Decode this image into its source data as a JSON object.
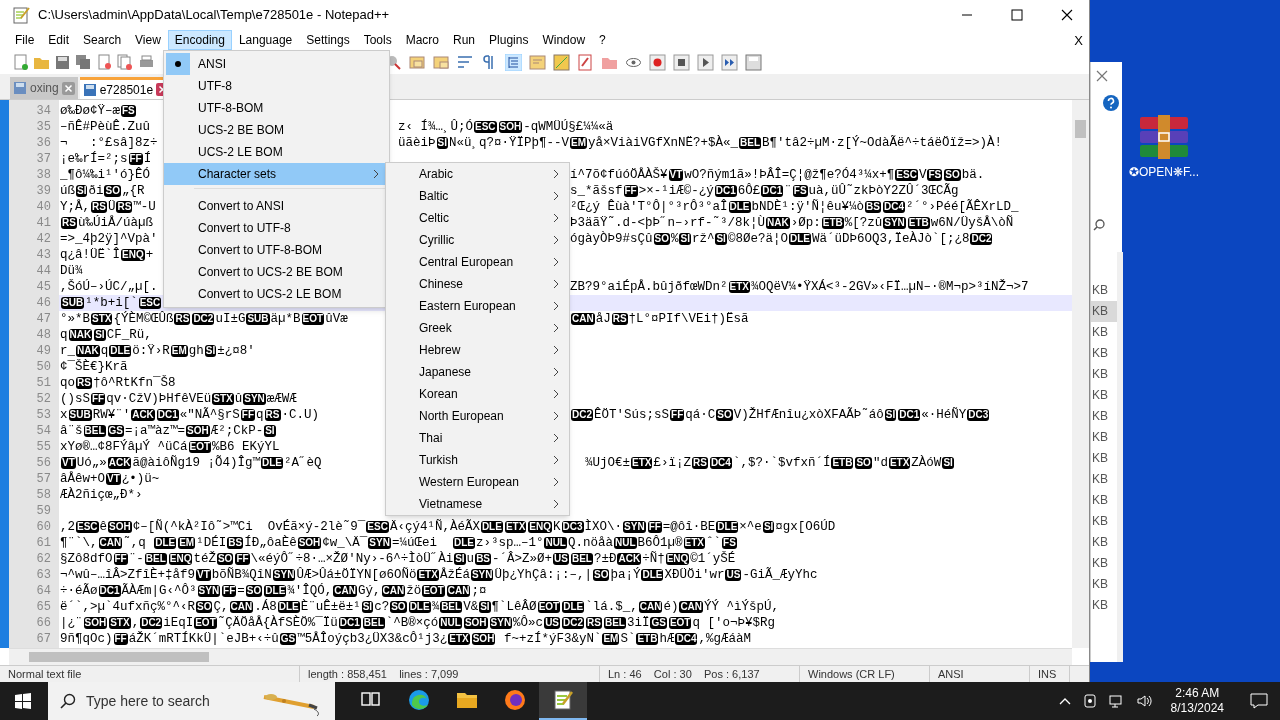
{
  "window": {
    "title": "C:\\Users\\admin\\AppData\\Local\\Temp\\e728501e - Notepad++"
  },
  "menu_bar": {
    "items": [
      {
        "label": "File",
        "selected": false
      },
      {
        "label": "Edit",
        "selected": false
      },
      {
        "label": "Search",
        "selected": false
      },
      {
        "label": "View",
        "selected": false
      },
      {
        "label": "Encoding",
        "selected": true
      },
      {
        "label": "Language",
        "selected": false
      },
      {
        "label": "Settings",
        "selected": false
      },
      {
        "label": "Tools",
        "selected": false
      },
      {
        "label": "Macro",
        "selected": false
      },
      {
        "label": "Run",
        "selected": false
      },
      {
        "label": "Plugins",
        "selected": false
      },
      {
        "label": "Window",
        "selected": false
      },
      {
        "label": "?",
        "selected": false
      }
    ],
    "close": "X"
  },
  "tabs": [
    {
      "label": "oxing",
      "selected": false
    },
    {
      "label": "e728501e",
      "selected": true
    }
  ],
  "editor": {
    "lines": [
      {
        "number": "34",
        "current": false,
        "left": [
          "ø‰Ðø¢Ÿ–æ",
          {
            "code": "FS"
          }
        ]
      },
      {
        "number": "35",
        "current": false,
        "left": [
          "–ñÊ#PèùÊ.Zuû"
        ],
        "right": [
          "z‹ Í¾…¸Û;Ó",
          {
            "code": "ESC"
          },
          {
            "code": "SOH"
          },
          "-qWMÜÚ§£¼¼«ä"
        ]
      },
      {
        "number": "36",
        "current": false,
        "left": [
          "¬   :°£sâ]8z÷"
        ],
        "right": [
          "üãèiÞ",
          {
            "code": "SI"
          },
          "N«ü¸q?¤·ŸÏPþ¶--V",
          {
            "code": "EM"
          },
          "yå×ViàiVGfXnNË?+$À«_",
          {
            "code": "BEL"
          },
          "B¶'tâ2÷µM·z[Ý~OdàÃë^÷táëÖïž=>)À!"
        ]
      },
      {
        "number": "37",
        "current": false,
        "left": [
          "¡e‰rÍ=²;s",
          {
            "code": "FF"
          },
          "Í"
        ]
      },
      {
        "number": "38",
        "current": false,
        "left": [
          "_¶ô¼‰i¹'ó}ÊÓ"
        ],
        "right": [
          "í^7õ¢fúóÖÅÀŠ¥",
          {
            "code": "VT"
          },
          "wO?ñým1ã»!ÞÂÎ=Ç¦@ž¶e?Ó4³¼x+¶",
          {
            "code": "ESC"
          },
          "V",
          {
            "code": "FS"
          },
          {
            "code": "SO"
          },
          "bä."
        ]
      },
      {
        "number": "39",
        "current": false,
        "left": [
          "úß",
          {
            "code": "SI"
          },
          "ði",
          {
            "code": "SO"
          },
          "„{R"
        ],
        "right": [
          "s_*ãšsf",
          {
            "code": "FF"
          },
          ">×-¹iÆ©-¿ý",
          {
            "code": "DC1"
          },
          "6Ô£",
          {
            "code": "DC1"
          },
          "¨",
          {
            "code": "FS"
          },
          "uà,üÛ˜zkÞòY2ZÛ´3ŒCÃg"
        ]
      },
      {
        "number": "40",
        "current": false,
        "left": [
          "Y;Å,",
          {
            "code": "RS"
          },
          "Ü",
          {
            "code": "RS"
          },
          "™-U"
        ],
        "right": [
          "²Œ¿ý Êùà'T°Ô|°³rÔ³°aÎ",
          {
            "code": "DLE"
          },
          "bNDÈ¹:ÿ'Ñ¦êu¥¼ò",
          {
            "code": "BS"
          },
          {
            "code": "DC4"
          },
          "²´°›Péé[ÃÊXrLD_"
        ]
      },
      {
        "number": "41",
        "current": false,
        "left": [
          {
            "code": "RS"
          },
          "ù‰ÚiÅ/úàµß"
        ],
        "right": [
          "Þ3äãŸ˜.d-<þÞ˝n–›rf-˜³/8k¦Ù",
          {
            "code": "NAK"
          },
          "›Øp:",
          {
            "code": "ETB"
          },
          "%[?zû",
          {
            "code": "SYN"
          },
          {
            "code": "ETB"
          },
          "w6N/ÜyšÅ\\òÑ"
        ]
      },
      {
        "number": "42",
        "current": false,
        "left": [
          "=>_4þ2ÿ]^Vpà'"
        ],
        "right": [
          "ógàyÒÞ9#sÇû",
          {
            "code": "SO"
          },
          "%",
          {
            "code": "SI"
          },
          "rž^",
          {
            "code": "SI"
          },
          "©8Øe?ä¦O",
          {
            "code": "DLE"
          },
          "Wä´üDÞ6OQ3,ÏeÀJò`[;¿8",
          {
            "code": "DC2"
          }
        ]
      },
      {
        "number": "43",
        "current": false,
        "left": [
          "q¿â!ÜË`Î",
          {
            "code": "ENQ"
          },
          "+"
        ]
      },
      {
        "number": "44",
        "current": false,
        "left": [
          "Dü¾"
        ]
      },
      {
        "number": "45",
        "current": false,
        "left": [
          ",ŠóÚ–›ÚC/„µ[."
        ],
        "right": [
          "ZB?9°aiÉpÅ.bûjðfœWDn²",
          {
            "code": "ETX"
          },
          "¾OQëV¼•ŸXÁ<³-2GV»‹FÏ…µN–·®M¬p>³íNŽ¬>7"
        ]
      },
      {
        "number": "46",
        "current": true,
        "left": [
          {
            "code": "SUB"
          },
          "¹*b+i[`",
          {
            "code": "ESC"
          }
        ]
      },
      {
        "number": "47",
        "current": false,
        "left": [
          "°»*B",
          {
            "code": "STX"
          },
          "{ÝÈM©ŒÛß",
          {
            "code": "RS"
          },
          {
            "code": "DC2"
          },
          "uI±G",
          {
            "code": "SUB"
          },
          "äµ*B",
          {
            "code": "EOT"
          },
          "ûVæ"
        ],
        "right": [
          {
            "code": "CAN"
          },
          "åJ",
          {
            "code": "RS"
          },
          "†L°¤PIf\\VEi†)Ësã"
        ]
      },
      {
        "number": "48",
        "current": false,
        "left": [
          "q",
          {
            "code": "NAK"
          },
          {
            "code": "SI"
          },
          "CF_Rü,"
        ]
      },
      {
        "number": "49",
        "current": false,
        "left": [
          "r_",
          {
            "code": "NAK"
          },
          "q",
          {
            "code": "DLE"
          },
          "ö:Ÿ›R",
          {
            "code": "EM"
          },
          "gh",
          {
            "code": "SI"
          },
          "±¿¤8'"
        ]
      },
      {
        "number": "50",
        "current": false,
        "left": [
          "¢¯ŠÈ€}Krã"
        ]
      },
      {
        "number": "51",
        "current": false,
        "left": [
          "qo",
          {
            "code": "RS"
          },
          "†ô^RtKfn¯Š8"
        ]
      },
      {
        "number": "52",
        "current": false,
        "left": [
          "()sS",
          {
            "code": "FF"
          },
          "qv·CžV)ÞHfêVEü",
          {
            "code": "STX"
          },
          "û",
          {
            "code": "SYN"
          },
          "æÆWÆ"
        ]
      },
      {
        "number": "53",
        "current": false,
        "left": [
          "x",
          {
            "code": "SUB"
          },
          "RW¥¨'",
          {
            "code": "ACK"
          },
          {
            "code": "DC1"
          },
          "«\"NÃ^§rS",
          {
            "code": "FF"
          },
          "q",
          {
            "code": "RS"
          },
          "·C.U)"
        ],
        "right": [
          {
            "code": "DC2"
          },
          "ÊÖT'Sús;sS",
          {
            "code": "FF"
          },
          "qá·C",
          {
            "code": "SO"
          },
          "V)ŽHfÆnîu¿xòXFAÃÞ˜áô",
          {
            "code": "SI"
          },
          {
            "code": "DC1"
          },
          "«·HéÑY",
          {
            "code": "DC3"
          }
        ]
      },
      {
        "number": "54",
        "current": false,
        "left": [
          "â¨š",
          {
            "code": "BEL"
          },
          {
            "code": "GS"
          },
          "=¡a™àz™=",
          {
            "code": "SOH"
          },
          "Æ²;CkP-",
          {
            "code": "SI"
          }
        ]
      },
      {
        "number": "55",
        "current": false,
        "left": [
          "xYø®…¢8FÝâµÝ ^üCá",
          {
            "code": "EOT"
          },
          "%B6 EKýYL"
        ]
      },
      {
        "number": "56",
        "current": false,
        "left": [
          {
            "code": "VT"
          },
          "Uó„»",
          {
            "code": "ACK"
          },
          "ã@àiôÑg19 ¡Õ4)Îg™",
          {
            "code": "DLE"
          },
          "²A˝èQ"
        ],
        "right": [
          "  ¾UjO€±",
          {
            "code": "ETX"
          },
          "£›ï¡Z",
          {
            "code": "RS"
          },
          {
            "code": "DC4"
          },
          "`,$?·`$vfxñ´Í",
          {
            "code": "ETB"
          },
          {
            "code": "SO"
          },
          "\"d",
          {
            "code": "ETX"
          },
          "ZÀóW",
          {
            "code": "SI"
          }
        ]
      },
      {
        "number": "57",
        "current": false,
        "left": [
          "âÅêw+O",
          {
            "code": "VT"
          },
          "¿•)ü~"
        ]
      },
      {
        "number": "58",
        "current": false,
        "left": [
          "ÆÀ2ñiçœ„Ð*›"
        ]
      },
      {
        "number": "59",
        "current": false
      },
      {
        "number": "60",
        "current": false,
        "left": [
          ",2",
          {
            "code": "ESC"
          },
          "ê",
          {
            "code": "SOH"
          },
          "¢–[Ñ(^kÀ²Iô˜>™Ci  OvÉã×ý-2lè˜9¯",
          {
            "code": "ESC"
          },
          "Ä‹çý4¹Ñ,ÀéÃX",
          {
            "code": "DLE"
          },
          {
            "code": "ETX"
          },
          {
            "code": "ENQ"
          },
          "K",
          {
            "code": "DC3"
          },
          "ÌXO\\·",
          {
            "code": "SYN"
          },
          {
            "code": "FF"
          },
          "=@ôî·BE",
          {
            "code": "DLE"
          },
          "×^e",
          {
            "code": "SI"
          },
          "¤gx[O6ÚD"
        ]
      },
      {
        "number": "61",
        "current": false,
        "left": [
          "¶¨`\\,",
          {
            "code": "CAN"
          },
          "˜,q ",
          {
            "code": "DLE"
          },
          {
            "code": "EM"
          },
          "¹DÉI",
          {
            "code": "BS"
          },
          "ÍÐ„ôaÈê",
          {
            "code": "SOH"
          },
          "¢w_\\Ä¯",
          {
            "code": "SYN"
          },
          "=¼úŒei  ",
          {
            "code": "DLE"
          },
          "z›³sp…–1°",
          {
            "code": "NUL"
          },
          "Q.nöåà",
          {
            "code": "NUL"
          },
          "B6Ô1µ®",
          {
            "code": "ETX"
          },
          "ˆ`",
          {
            "code": "FS"
          }
        ]
      },
      {
        "number": "62",
        "current": false,
        "left": [
          "§Zô8dfO",
          {
            "code": "FF"
          },
          "¨-",
          {
            "code": "BEL"
          },
          {
            "code": "ENQ"
          },
          "téŽ",
          {
            "code": "SO"
          },
          {
            "code": "FF"
          },
          "\\«éýÔ˝÷8·…×ŽØ'Ny›-6^÷ÌòÜ˝Ài",
          {
            "code": "SI"
          },
          "u",
          {
            "code": "BS"
          },
          "-´Â>Z»Ø+",
          {
            "code": "US"
          },
          {
            "code": "BEL"
          },
          "?±Ð",
          {
            "code": "ACK"
          },
          "÷Ñ†",
          {
            "code": "ENQ"
          },
          "©1´yŠÉ"
        ]
      },
      {
        "number": "63",
        "current": false,
        "left": [
          "¬^wû–…îÂ>ZfîÈ+‡åf9",
          {
            "code": "VT"
          },
          "bõÑB¾QîN",
          {
            "code": "SYN"
          },
          "ÛÆ>Ûá±ÖÏYN[ø6OÑö",
          {
            "code": "ETX"
          },
          "ÅžÉá",
          {
            "code": "SYN"
          },
          "Üþ¿YhÇâ:¡:–,|",
          {
            "code": "SO"
          },
          "þa¡Ý",
          {
            "code": "DLE"
          },
          "XÐÜÖi'wr",
          {
            "code": "US"
          },
          "-GiÃ_ÆyYhc"
        ]
      },
      {
        "number": "64",
        "current": false,
        "left": [
          "÷·éÃø",
          {
            "code": "DC1"
          },
          "ÃÀÆm|G‹^Ô³",
          {
            "code": "SYN"
          },
          {
            "code": "FF"
          },
          "=",
          {
            "code": "SO"
          },
          {
            "code": "DLE"
          },
          "¾'ÎQÓ,",
          {
            "code": "CAN"
          },
          "Gý,",
          {
            "code": "CAN"
          },
          "žö",
          {
            "code": "EOT"
          },
          {
            "code": "CAN"
          },
          ";¤"
        ]
      },
      {
        "number": "65",
        "current": false,
        "left": [
          "ë´`,>µ`4ufxñç%°^‹R",
          {
            "code": "SO"
          },
          "Ç,",
          {
            "code": "CAN"
          },
          ".Á8",
          {
            "code": "DLE"
          },
          "È¨uÊ±ë±¹",
          {
            "code": "SI"
          },
          "c?",
          {
            "code": "SO"
          },
          {
            "code": "DLE"
          },
          "¾",
          {
            "code": "BEL"
          },
          "V&",
          {
            "code": "SI"
          },
          "¶`LêÂØ",
          {
            "code": "EOT"
          },
          {
            "code": "DLE"
          },
          "`lá.$_,",
          {
            "code": "CAN"
          },
          "é)",
          {
            "code": "CAN"
          },
          "ÝÝ ^ìÝšpÚ,"
        ]
      },
      {
        "number": "66",
        "current": false,
        "left": [
          "|¿¨",
          {
            "code": "SOH"
          },
          {
            "code": "STX"
          },
          ",",
          {
            "code": "DC2"
          },
          "iEqI",
          {
            "code": "EOT"
          },
          "˜ÇÄÖåÅ{ÀfSÈÖ%¯Ïü",
          {
            "code": "DC1"
          },
          {
            "code": "BEL"
          },
          "`^B®×çó",
          {
            "code": "NUL"
          },
          {
            "code": "SOH"
          },
          {
            "code": "SYN"
          },
          "%Ô»c",
          {
            "code": "US"
          },
          {
            "code": "DC2"
          },
          {
            "code": "RS"
          },
          {
            "code": "BEL"
          },
          "3iÏ",
          {
            "code": "GS"
          },
          {
            "code": "EOT"
          },
          "q ['o¬Þ¥$Rg"
        ]
      },
      {
        "number": "67",
        "current": false,
        "left": [
          "9ñ¶qOc)",
          {
            "code": "FF"
          },
          "áŽK´mRTÍKkÜ|`eJB+‹÷û",
          {
            "code": "GS"
          },
          "™5ÅÎoýçb3¿ÜX3&cÔ¹j3¿",
          {
            "code": "ETX"
          },
          {
            "code": "SOH"
          },
          " f~+zÍ*ýF3&yN`",
          {
            "code": "EM"
          },
          "S`",
          {
            "code": "ETB"
          },
          "hÆ",
          {
            "code": "DC4"
          },
          ",%gÆáàM"
        ]
      }
    ]
  },
  "encoding_menu": {
    "items": [
      {
        "kind": "option",
        "label": "ANSI",
        "checked": true,
        "selected": false
      },
      {
        "kind": "option",
        "label": "UTF-8",
        "checked": false,
        "selected": false
      },
      {
        "kind": "option",
        "label": "UTF-8-BOM",
        "checked": false,
        "selected": false
      },
      {
        "kind": "option",
        "label": "UCS-2 BE BOM",
        "checked": false,
        "selected": false
      },
      {
        "kind": "option",
        "label": "UCS-2 LE BOM",
        "checked": false,
        "selected": false
      },
      {
        "kind": "submenu",
        "label": "Character sets",
        "selected": true
      },
      {
        "kind": "separator"
      },
      {
        "kind": "command",
        "label": "Convert to ANSI",
        "selected": false
      },
      {
        "kind": "command",
        "label": "Convert to UTF-8",
        "selected": false
      },
      {
        "kind": "command",
        "label": "Convert to UTF-8-BOM",
        "selected": false
      },
      {
        "kind": "command",
        "label": "Convert to UCS-2 BE BOM",
        "selected": false
      },
      {
        "kind": "command",
        "label": "Convert to UCS-2 LE BOM",
        "selected": false
      }
    ]
  },
  "character_sets_menu": {
    "items": [
      "Arabic",
      "Baltic",
      "Celtic",
      "Cyrillic",
      "Central European",
      "Chinese",
      "Eastern European",
      "Greek",
      "Hebrew",
      "Japanese",
      "Korean",
      "North European",
      "Thai",
      "Turkish",
      "Western European",
      "Vietnamese"
    ]
  },
  "status_bar": [
    "Normal text file",
    "length : 858,451    lines : 7,099",
    "Ln : 46    Col : 30    Pos : 6,137",
    "Windows (CR LF)",
    "ANSI",
    "INS"
  ],
  "explorer": {
    "sizes": [
      {
        "text": "KB",
        "selected": false
      },
      {
        "text": "KB",
        "selected": true
      },
      {
        "text": "KB",
        "selected": false
      },
      {
        "text": "KB",
        "selected": false
      },
      {
        "text": "KB",
        "selected": false
      },
      {
        "text": "KB",
        "selected": false
      },
      {
        "text": "KB",
        "selected": false
      },
      {
        "text": "KB",
        "selected": false
      },
      {
        "text": "KB",
        "selected": false
      },
      {
        "text": "KB",
        "selected": false
      },
      {
        "text": "KB",
        "selected": false
      },
      {
        "text": "KB",
        "selected": false
      },
      {
        "text": "KB",
        "selected": false
      },
      {
        "text": "KB",
        "selected": false
      },
      {
        "text": "KB",
        "selected": false
      },
      {
        "text": "KB",
        "selected": false
      }
    ]
  },
  "desktop_icon": {
    "label": "✪OPEN❋F..."
  },
  "taskbar": {
    "search_placeholder": "Type here to search",
    "time": "2:46 AM",
    "date": "8/13/2024",
    "apps": [
      {
        "kind": "taskview",
        "selected": false
      },
      {
        "kind": "edge",
        "selected": false
      },
      {
        "kind": "folder",
        "selected": false
      },
      {
        "kind": "firefox",
        "selected": false
      },
      {
        "kind": "notepad",
        "selected": true
      }
    ]
  }
}
